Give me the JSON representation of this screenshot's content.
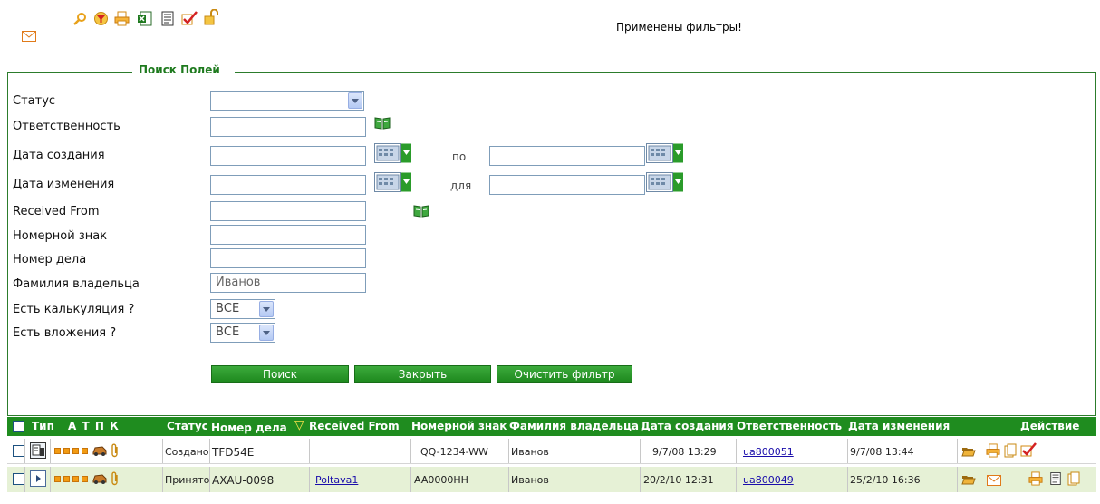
{
  "toolbar": {
    "icons": [
      "mail-icon",
      "search-icon",
      "filter-icon",
      "print-icon",
      "excel-icon",
      "report-icon",
      "check-icon",
      "unlock-icon"
    ],
    "message": "Применены фильтры!"
  },
  "search_panel": {
    "legend": "Поиск Полей",
    "fields": {
      "status": {
        "label": "Статус",
        "value": ""
      },
      "responsibility": {
        "label": "Ответственность",
        "value": ""
      },
      "created": {
        "label": "Дата создания",
        "value": "",
        "to_label": "по",
        "to_value": ""
      },
      "modified": {
        "label": "Дата изменения",
        "value": "",
        "to_label": "для",
        "to_value": ""
      },
      "received_from": {
        "label": "Received From",
        "value": ""
      },
      "plate": {
        "label": "Номерной знак",
        "value": ""
      },
      "case_number": {
        "label": "Номер дела",
        "value": ""
      },
      "owner_name": {
        "label": "Фамилия владельца",
        "value": "",
        "placeholder": "Иванов"
      },
      "has_calc": {
        "label": "Есть калькуляция ?",
        "value": "ВСЕ"
      },
      "has_attach": {
        "label": "Есть вложения ?",
        "value": "ВСЕ"
      }
    },
    "buttons": {
      "search": "Поиск",
      "close": "Закрыть",
      "clear": "Очистить фильтр"
    }
  },
  "grid": {
    "headers": {
      "type": "Тип",
      "atpk": "А Т П К",
      "status": "Статус",
      "case_number": "Номер дела",
      "sort_mark": "▽",
      "received_from": "Received From",
      "plate": "Номерной знак",
      "owner": "Фамилия владельца",
      "created": "Дата создания",
      "responsible": "Ответственность",
      "modified": "Дата изменения",
      "action": "Действие"
    },
    "rows": [
      {
        "status": "Создано",
        "case_number": "TFD54E",
        "received_from": "",
        "plate": "QQ-1234-WW",
        "owner": "Иванов",
        "created": "9/7/08 13:29",
        "responsible": "ua800051",
        "modified": "9/7/08 13:44"
      },
      {
        "status": "Принято",
        "case_number": "AXAU-0098",
        "received_from": "Poltava1",
        "plate": "AA0000HH",
        "owner": "Иванов",
        "created": "20/2/10 12:31",
        "responsible": "ua800049",
        "modified": "25/2/10 16:36"
      }
    ]
  },
  "colors": {
    "accent": "#1f8c1f",
    "row_alt": "#e6f1d6",
    "link": "#1a0dab"
  }
}
